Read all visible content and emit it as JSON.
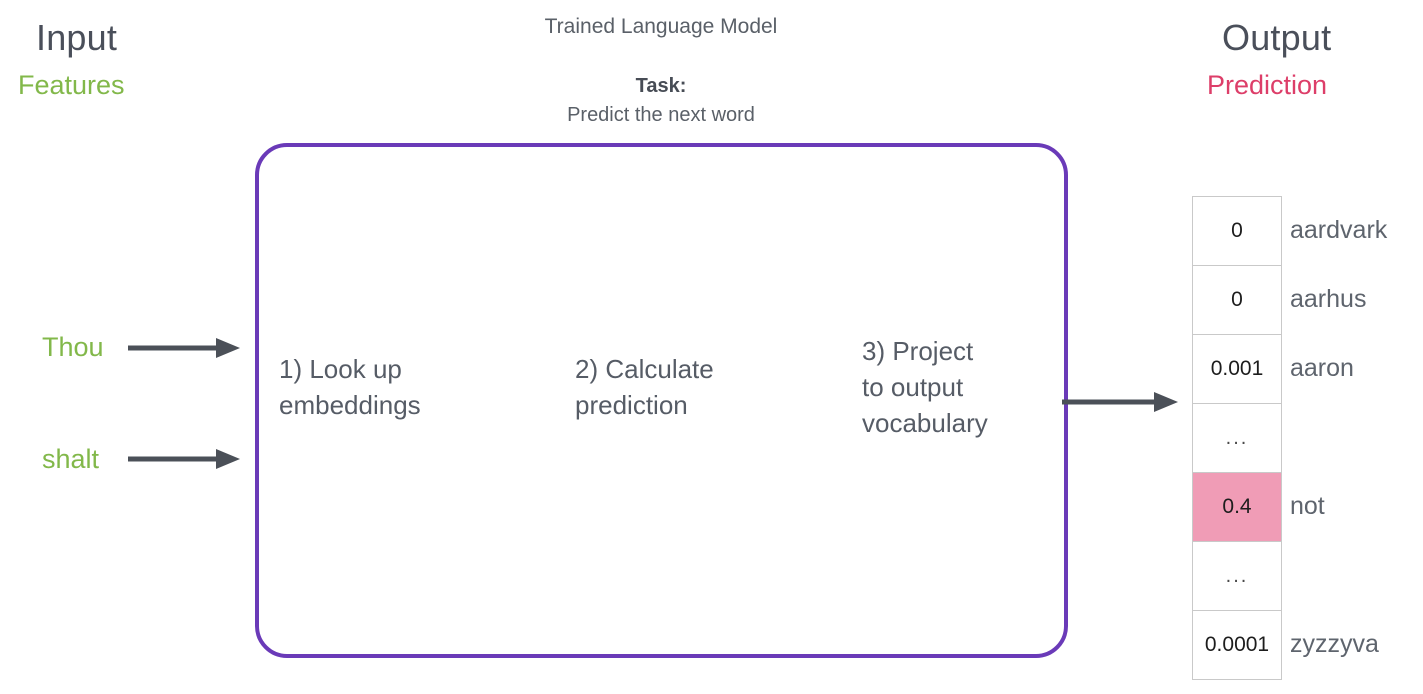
{
  "input": {
    "heading": "Input",
    "subheading": "Features",
    "words": [
      "Thou",
      "shalt"
    ],
    "arrow_icon": "arrow-right-icon",
    "color": "#82b84a"
  },
  "model": {
    "title": "Trained Language Model",
    "task_label": "Task:",
    "task_description": "Predict the next word",
    "border_color": "#6a3ab8",
    "steps": [
      {
        "id": "step-1",
        "text": "1) Look up\nembeddings"
      },
      {
        "id": "step-2",
        "text": "2) Calculate\nprediction"
      },
      {
        "id": "step-3",
        "text": "3) Project\nto output\nvocabulary"
      }
    ]
  },
  "output": {
    "heading": "Output",
    "subheading": "Prediction",
    "arrow_icon": "arrow-right-icon",
    "color": "#dd3e69",
    "highlight_color": "#f09cb6",
    "rows": [
      {
        "value": "0",
        "word": "aardvark",
        "highlight": false
      },
      {
        "value": "0",
        "word": "aarhus",
        "highlight": false
      },
      {
        "value": "0.001",
        "word": "aaron",
        "highlight": false
      },
      {
        "value": "...",
        "word": "",
        "highlight": false
      },
      {
        "value": "0.4",
        "word": "not",
        "highlight": true
      },
      {
        "value": "...",
        "word": "",
        "highlight": false
      },
      {
        "value": "0.0001",
        "word": "zyzzyva",
        "highlight": false
      }
    ]
  }
}
